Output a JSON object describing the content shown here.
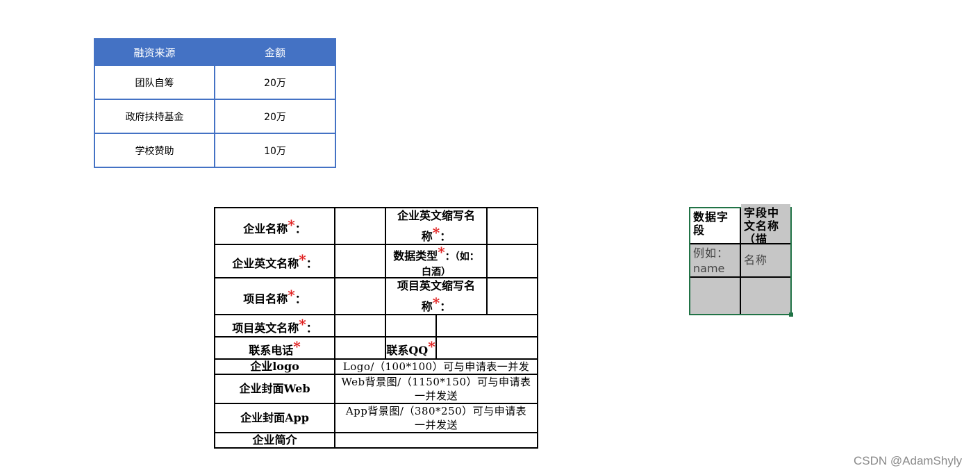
{
  "funding_table": {
    "headers": [
      "融资来源",
      "金额"
    ],
    "rows": [
      [
        "团队自筹",
        "20万"
      ],
      [
        "政府扶持基金",
        "20万"
      ],
      [
        "学校赞助",
        "10万"
      ]
    ],
    "colors": {
      "header_bg": "#4472c4",
      "border": "#4472c4",
      "header_text": "#ffffff"
    }
  },
  "form": {
    "company_name": "企业名称",
    "company_en_abbr_line1": "企业英文缩写名",
    "company_en_abbr_line2": "称",
    "company_en_name": "企业英文名称",
    "data_type": "数据类型",
    "data_type_hint_line1": "：（如：",
    "data_type_hint_line2": "白酒）",
    "project_name": "项目名称",
    "project_en_abbr_line1": "项目英文缩写名",
    "project_en_abbr_line2": "称",
    "project_en_name": "项目英文名称",
    "contact_phone": "联系电话",
    "contact_qq": "联系QQ",
    "logo_label": "企业logo",
    "logo_value": "Logo/（100*100）可与申请表一并发",
    "cover_web_label": "企业封面Web",
    "cover_web_value_line1": "Web背景图/（1150*150）可与申请表",
    "cover_web_value_line2": "一并发送",
    "cover_app_label": "企业封面App",
    "cover_app_value_line1": "App背景图/（380*250）可与申请表",
    "cover_app_value_line2": "一并发送",
    "intro_label": "企业简介",
    "required_mark": "*",
    "colon": "：",
    "colors": {
      "required": "#e02020",
      "border": "#000000"
    }
  },
  "dictionary": {
    "header_field": "数据字段",
    "header_name": "字段中文名称（描",
    "example_field_line1": "例如：",
    "example_field_line2": "name",
    "example_name": "名称",
    "colors": {
      "cell_bg": "#c6c6c6",
      "selection_border": "#217346"
    }
  },
  "watermark": "CSDN @AdamShyly"
}
